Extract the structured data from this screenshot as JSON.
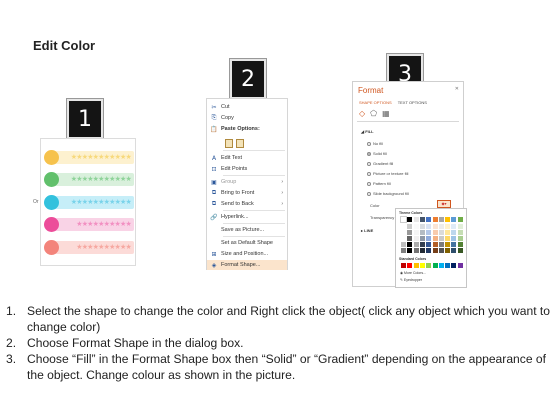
{
  "page_title": "Edit Color",
  "badges": [
    "1",
    "2",
    "3"
  ],
  "panel1": {
    "or_label": "Or",
    "rows": [
      {
        "circle": "#f6c24c",
        "bar": "#fdf1cf",
        "stars": "★★★★★★★★★★★",
        "star_color": "#f7d97c"
      },
      {
        "circle": "#61c06b",
        "bar": "#d9f0dc",
        "stars": "★★★★★★★★★★★",
        "star_color": "#8fd39a"
      },
      {
        "circle": "#33c1dd",
        "bar": "#c6eef8",
        "stars": "★★★★★★★★★★★",
        "star_color": "#7ad3ea"
      },
      {
        "circle": "#ec4d9a",
        "bar": "#f9d3e6",
        "stars": "★★★★★★★★★★",
        "star_color": "#f290c2"
      },
      {
        "circle": "#f3847b",
        "bar": "#fcdbd8",
        "stars": "★★★★★★★★★★",
        "star_color": "#f6a8a1"
      }
    ]
  },
  "context_menu": {
    "items": [
      {
        "icon": "✂",
        "label": "Cut",
        "arrow": ""
      },
      {
        "icon": "⎘",
        "label": "Copy",
        "arrow": ""
      },
      {
        "icon": "📋",
        "label": "Paste Options:",
        "arrow": ""
      },
      {
        "icon": "",
        "label": "",
        "arrow": ""
      },
      {
        "icon": "A",
        "label": "Edit Text",
        "arrow": ""
      },
      {
        "icon": "⊡",
        "label": "Edit Points",
        "arrow": ""
      },
      {
        "icon": "▣",
        "label": "Group",
        "arrow": "›"
      },
      {
        "icon": "⧉",
        "label": "Bring to Front",
        "arrow": "›"
      },
      {
        "icon": "⧉",
        "label": "Send to Back",
        "arrow": "›"
      },
      {
        "icon": "🔗",
        "label": "Hyperlink...",
        "arrow": ""
      },
      {
        "icon": "",
        "label": "Save as Picture...",
        "arrow": ""
      },
      {
        "icon": "",
        "label": "Set as Default Shape",
        "arrow": ""
      },
      {
        "icon": "⊞",
        "label": "Size and Position...",
        "arrow": ""
      },
      {
        "icon": "◈",
        "label": "Format Shape...",
        "arrow": ""
      }
    ]
  },
  "format_pane": {
    "title": "Format",
    "close": "✕",
    "tabs": [
      "SHAPE OPTIONS",
      "TEXT OPTIONS"
    ],
    "icons": [
      "◇",
      "⬠",
      "▦"
    ],
    "fill_header": "◢ FILL",
    "fill_options": [
      "No fill",
      "Solid fill",
      "Gradient fill",
      "Picture or texture fill",
      "Pattern fill",
      "Slide background fill"
    ],
    "color_label": "Color",
    "color_button": "◆▾",
    "transparency_label": "Transparency",
    "line_header": "▸ LINE",
    "palette": {
      "theme_header": "Theme Colors",
      "standard_header": "Standard Colors",
      "more_colors": "More Colors...",
      "eyedropper": "Eyedropper",
      "theme_top": [
        "#ffffff",
        "#000000",
        "#e7e6e6",
        "#44546a",
        "#4472c4",
        "#ed7d31",
        "#a5a5a5",
        "#ffc000",
        "#5b9bd5",
        "#70ad47"
      ],
      "standard": [
        "#c00000",
        "#ff0000",
        "#ffc000",
        "#ffff00",
        "#92d050",
        "#00b050",
        "#00b0f0",
        "#0070c0",
        "#002060",
        "#7030a0"
      ]
    }
  },
  "instructions": [
    {
      "num": "1.",
      "text": "Select the shape to change the color and Right click the object( click any object which you want to change color)"
    },
    {
      "num": "2.",
      "text": "Choose Format Shape in the dialog box."
    },
    {
      "num": "3.",
      "text": "Choose “Fill” in the Format Shape box then “Solid” or “Gradient” depending on the appearance of the object. Change colour as shown in the picture."
    }
  ]
}
